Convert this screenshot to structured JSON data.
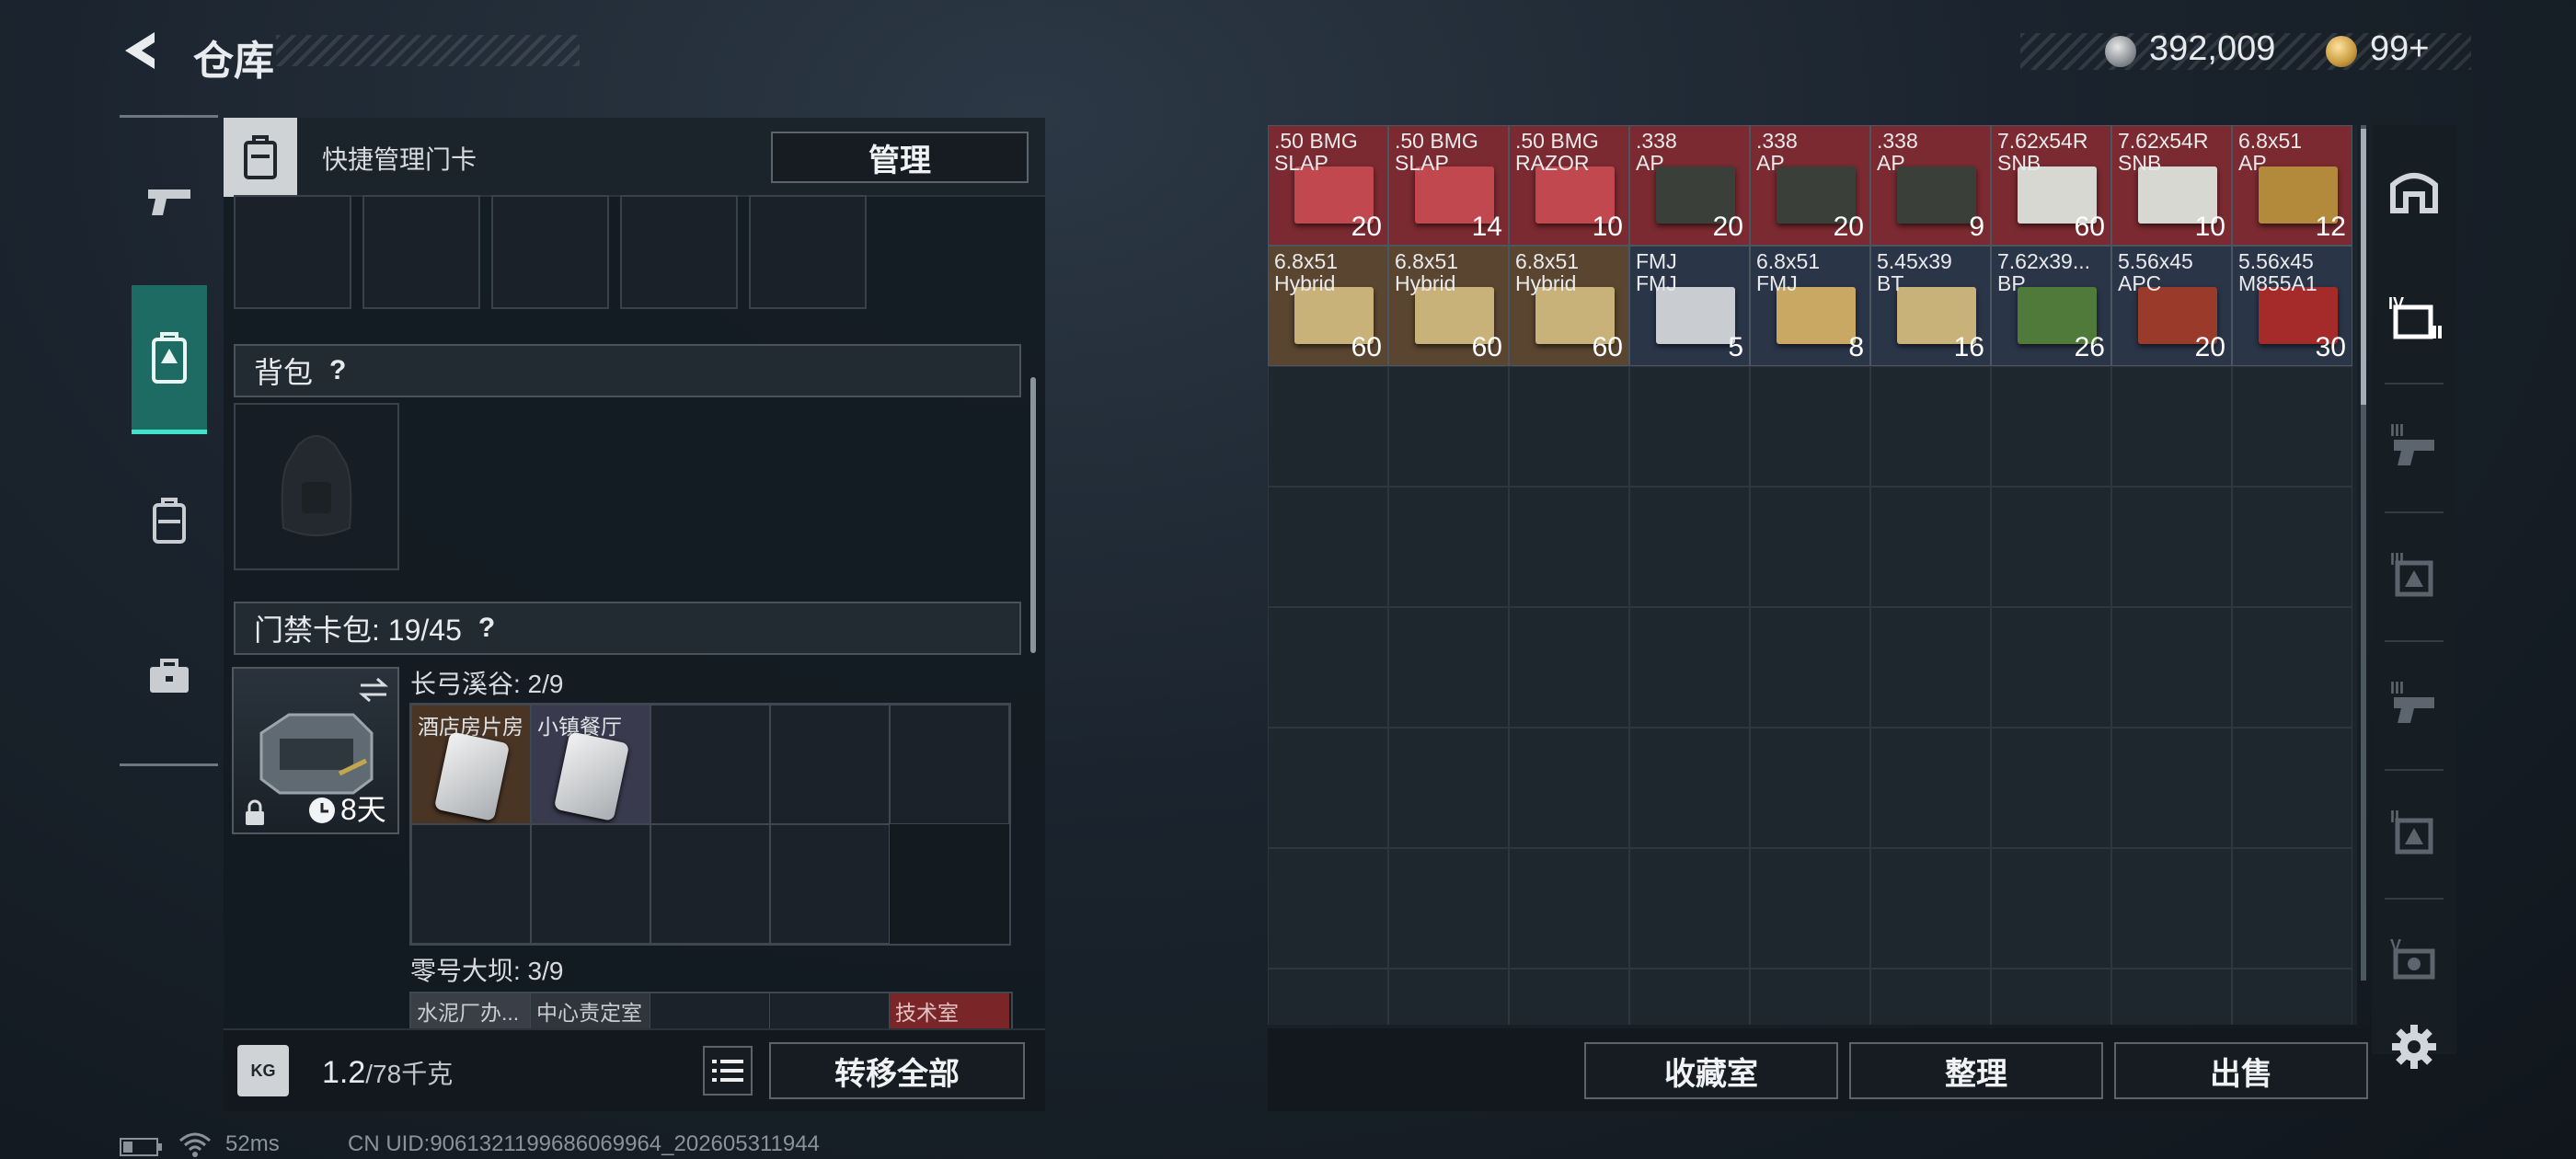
{
  "header": {
    "title": "仓库",
    "currency": [
      {
        "name": "silver-coin",
        "value": "392,009"
      },
      {
        "name": "gold-coin",
        "value": "99+"
      }
    ]
  },
  "quick_manage": {
    "label": "快捷管理门卡",
    "button": "管理"
  },
  "backpack": {
    "label": "背包",
    "help": "?"
  },
  "keycard_pack": {
    "label": "门禁卡包: 19/45",
    "help": "?",
    "duration": "8天"
  },
  "key_groups": [
    {
      "title": "长弓溪谷: 2/9",
      "cards": [
        "酒店房片房",
        "小镇餐厅"
      ]
    },
    {
      "title": "零号大坝: 3/9",
      "cards": [
        "水泥厂办...",
        "中心责定室",
        "技术室"
      ]
    }
  ],
  "bottom_left": {
    "weight": "1.2",
    "weight_max": "/78千克",
    "transfer": "转移全部"
  },
  "stash_items": [
    {
      "name": ".50 BMG\nSLAP",
      "count": "20",
      "bg": "#7a2a30",
      "box": "#c2484f"
    },
    {
      "name": ".50 BMG\nSLAP",
      "count": "14",
      "bg": "#7a2a30",
      "box": "#c2484f"
    },
    {
      "name": ".50 BMG\nRAZOR",
      "count": "10",
      "bg": "#7a2a30",
      "box": "#c2484f"
    },
    {
      "name": ".338\nAP",
      "count": "20",
      "bg": "#7a2a30",
      "box": "#3a3f3a"
    },
    {
      "name": ".338\nAP",
      "count": "20",
      "bg": "#7a2a30",
      "box": "#3a3f3a"
    },
    {
      "name": ".338\nAP",
      "count": "9",
      "bg": "#7a2a30",
      "box": "#3a3f3a"
    },
    {
      "name": "7.62x54R\nSNB",
      "count": "60",
      "bg": "#7a2a30",
      "box": "#d8d8d2"
    },
    {
      "name": "7.62x54R\nSNB",
      "count": "10",
      "bg": "#7a2a30",
      "box": "#d8d8d2"
    },
    {
      "name": "6.8x51\nAP",
      "count": "12",
      "bg": "#7a2a30",
      "box": "#b38a3c"
    },
    {
      "name": "6.8x51\nHybrid",
      "count": "60",
      "bg": "#5a4530",
      "box": "#c9b27a"
    },
    {
      "name": "6.8x51\nHybrid",
      "count": "60",
      "bg": "#5a4530",
      "box": "#c9b27a"
    },
    {
      "name": "6.8x51\nHybrid",
      "count": "60",
      "bg": "#5a4530",
      "box": "#c9b27a"
    },
    {
      "name": "FMJ\nFMJ",
      "count": "5",
      "bg": "#2a3548",
      "box": "#c9ccd0"
    },
    {
      "name": "6.8x51\nFMJ",
      "count": "8",
      "bg": "#2a3548",
      "box": "#c9a864"
    },
    {
      "name": "5.45x39\nBT",
      "count": "16",
      "bg": "#2a3548",
      "box": "#c9b27a"
    },
    {
      "name": "7.62x39...\nBP",
      "count": "26",
      "bg": "#2a3548",
      "box": "#4f7a3a"
    },
    {
      "name": "5.56x45\nAPC",
      "count": "20",
      "bg": "#2a3548",
      "box": "#9a3a2a"
    },
    {
      "name": "5.56x45\nM855A1",
      "count": "30",
      "bg": "#2a3548",
      "box": "#a52a2a"
    }
  ],
  "stash_buttons": [
    "收藏室",
    "整理",
    "出售"
  ],
  "status": {
    "ping": "52ms",
    "uid": "CN UID:9061321199686069964_202605311944"
  }
}
